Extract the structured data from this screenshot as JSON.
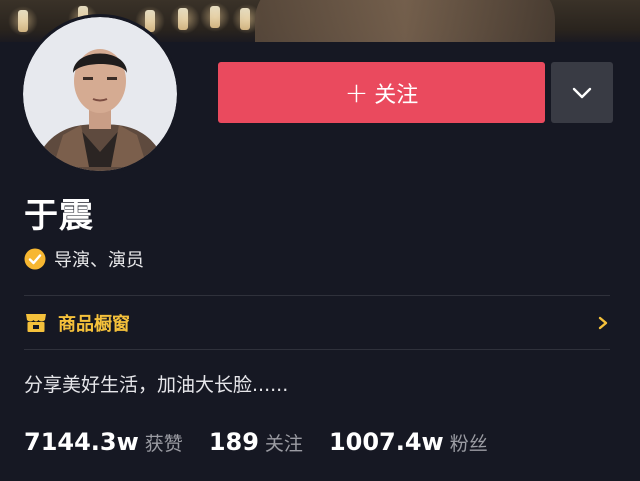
{
  "profile": {
    "name": "于震",
    "verified_title": "导演、演员",
    "bio": "分享美好生活，加油大长脸......"
  },
  "actions": {
    "follow_label": "关注",
    "follow_plus": "+"
  },
  "shop": {
    "label": "商品橱窗"
  },
  "stats": [
    {
      "value": "7144.3w",
      "label": "获赞"
    },
    {
      "value": "189",
      "label": "关注"
    },
    {
      "value": "1007.4w",
      "label": "粉丝"
    }
  ],
  "icons": {
    "verified": "verified-check-icon",
    "shop": "storefront-icon",
    "chevron_right": "chevron-right-icon",
    "dropdown": "chevron-down-icon"
  },
  "colors": {
    "background": "#161823",
    "follow_button": "#ea4a5e",
    "shop_accent": "#f5c13b",
    "verified_badge": "#f7b731"
  }
}
